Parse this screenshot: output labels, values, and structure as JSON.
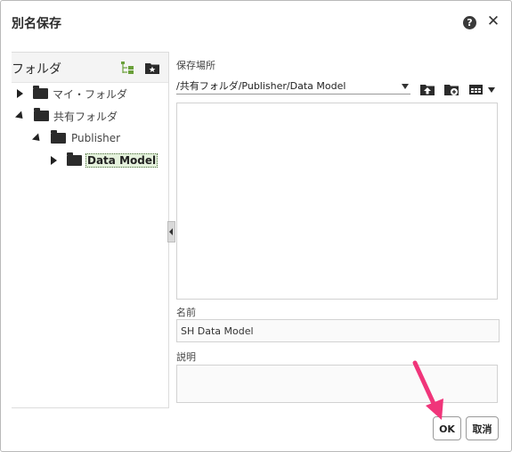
{
  "dialog": {
    "title": "別名保存",
    "help_symbol": "?",
    "close_symbol": "✕"
  },
  "folder_pane": {
    "header_label": "フォルダ",
    "tree": [
      {
        "label": "マイ・フォルダ",
        "expanded": false,
        "level": 0
      },
      {
        "label": "共有フォルダ",
        "expanded": true,
        "level": 0
      },
      {
        "label": "Publisher",
        "expanded": true,
        "level": 1
      },
      {
        "label": "Data Model",
        "expanded": false,
        "level": 2,
        "selected": true
      }
    ]
  },
  "location": {
    "label": "保存場所",
    "path": "/共有フォルダ/Publisher/Data Model"
  },
  "name": {
    "label": "名前",
    "value": "SH Data Model"
  },
  "description": {
    "label": "説明",
    "value": ""
  },
  "buttons": {
    "ok": "OK",
    "cancel": "取消"
  },
  "colors": {
    "annotation_arrow": "#f0357a",
    "tree_icon_green": "#6aa03a",
    "selected_bg": "#e4f1dc"
  }
}
